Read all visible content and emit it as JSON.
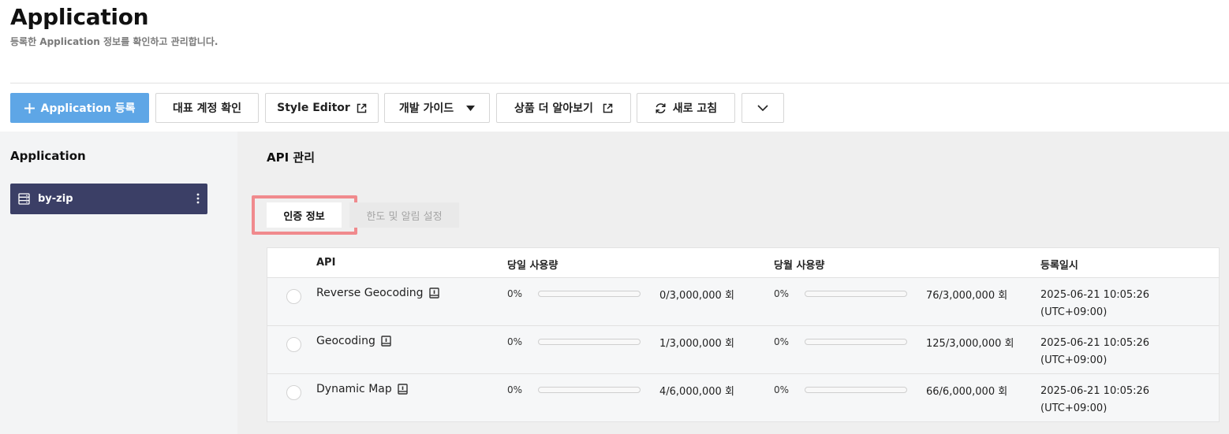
{
  "header": {
    "title": "Application",
    "subtitle": "등록한 Application 정보를 확인하고 관리합니다."
  },
  "toolbar": {
    "register_label": "Application 등록",
    "account_label": "대표 계정 확인",
    "style_editor_label": "Style Editor",
    "dev_guide_label": "개발 가이드",
    "learn_more_label": "상품 더 알아보기",
    "refresh_label": "새로 고침"
  },
  "sidebar": {
    "title": "Application",
    "items": [
      {
        "label": "by-zip",
        "selected": true
      }
    ]
  },
  "main": {
    "title": "API 관리",
    "tabs": [
      {
        "label": "인증 정보",
        "active": true
      },
      {
        "label": "한도 및 알림 설정",
        "active": false
      }
    ],
    "table": {
      "headers": {
        "api": "API",
        "daily": "당일 사용량",
        "monthly": "당월 사용량",
        "registered": "등록일시"
      },
      "rows": [
        {
          "name": "Reverse Geocoding",
          "daily_pct": "0%",
          "daily_fraction": 0.0,
          "daily_count": "0/3,000,000 회",
          "monthly_pct": "0%",
          "monthly_fraction": 0.0,
          "monthly_count": "76/3,000,000 회",
          "date": "2025-06-21 10:05:26",
          "tz": "(UTC+09:00)"
        },
        {
          "name": "Geocoding",
          "daily_pct": "0%",
          "daily_fraction": 0.0,
          "daily_count": "1/3,000,000 회",
          "monthly_pct": "0%",
          "monthly_fraction": 0.0,
          "monthly_count": "125/3,000,000 회",
          "date": "2025-06-21 10:05:26",
          "tz": "(UTC+09:00)"
        },
        {
          "name": "Dynamic Map",
          "daily_pct": "0%",
          "daily_fraction": 0.0,
          "daily_count": "4/6,000,000 회",
          "monthly_pct": "0%",
          "monthly_fraction": 0.0,
          "monthly_count": "66/6,000,000 회",
          "date": "2025-06-21 10:05:26",
          "tz": "(UTC+09:00)"
        }
      ]
    }
  },
  "colors": {
    "primary": "#5ea6e6",
    "sidebar_selected": "#3b3f66",
    "highlight": "#f08a8d"
  },
  "icons": {
    "register": "plus-icon",
    "external": "external-link-icon",
    "dropdown": "caret-down-icon",
    "refresh": "refresh-icon",
    "more": "chevron-down-icon",
    "app": "server-icon",
    "menu": "kebab-icon",
    "doc": "document-icon"
  }
}
